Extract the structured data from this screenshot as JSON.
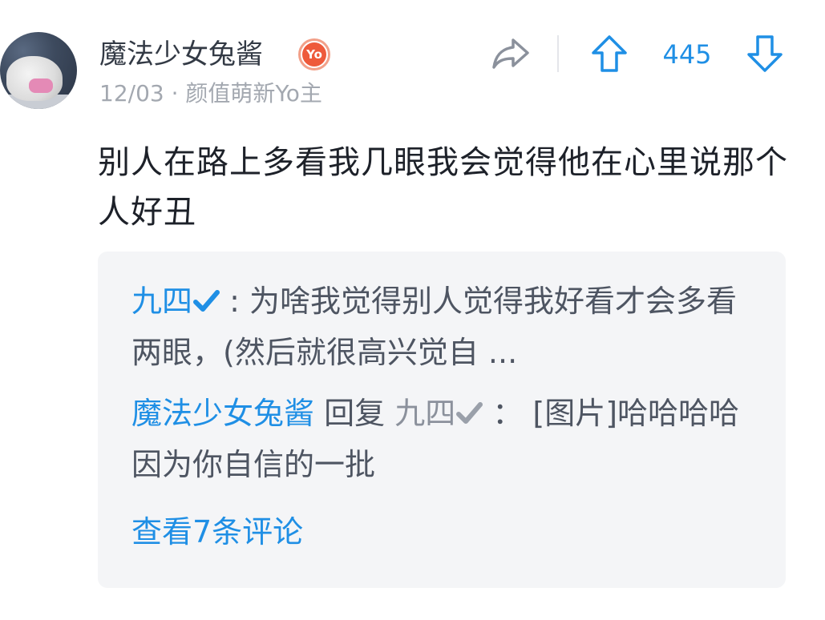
{
  "post": {
    "author": {
      "name": "魔法少女兔酱",
      "badge_text": "Yo"
    },
    "meta": "12/03 · 颜值萌新Yo主",
    "votes": "445",
    "content": "别人在路上多看我几眼我会觉得他在心里说那个人好丑"
  },
  "comments": [
    {
      "author": "九四",
      "separator": " : ",
      "text": "为啥我觉得别人觉得我好看才会多看两眼，(然后就很高兴觉自 ..."
    },
    {
      "author": "魔法少女兔酱",
      "reply_word": " 回复 ",
      "reply_to": "九四",
      "separator": " ： ",
      "text": "[图片]哈哈哈哈因为你自信的一批"
    }
  ],
  "view_more_label": "查看7条评论",
  "icons": {
    "share": "share-icon",
    "upvote": "arrow-up-icon",
    "downvote": "arrow-down-icon",
    "verified": "checkmark-icon"
  },
  "colors": {
    "accent": "#1f8fe5",
    "badge": "#ee5a3b",
    "card_bg": "#f4f5f7"
  }
}
